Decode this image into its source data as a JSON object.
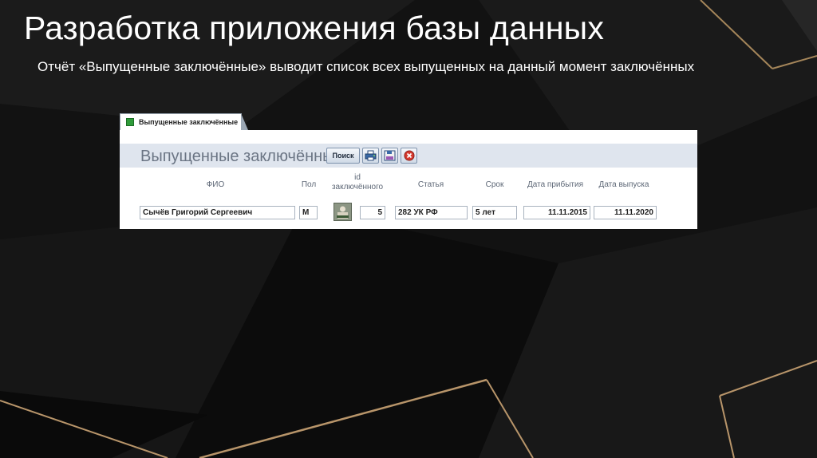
{
  "slide": {
    "title": "Разработка приложения базы данных",
    "subtitle": "Отчёт «Выпущенные заключённые» выводит список всех выпущенных на данный момент заключённых"
  },
  "form": {
    "tab_label": "Выпущенные заключённые",
    "caption": "Выпущенные заключённые",
    "search_label": "Поиск",
    "icons": {
      "print": "printer-icon",
      "save": "save-icon",
      "close": "close-icon"
    },
    "colors": {
      "header_band": "#dfe5ee",
      "caption_text": "#6b7584",
      "close_red": "#d63a2f"
    },
    "columns": {
      "fio": "ФИО",
      "gender": "Пол",
      "id_line1": "id",
      "id_line2": "заключённого",
      "article": "Статья",
      "term": "Срок",
      "arrival": "Дата прибытия",
      "release": "Дата выпуска"
    },
    "row": {
      "fio": "Сычёв Григорий Сергеевич",
      "gender": "М",
      "id": "5",
      "article": "282 УК РФ",
      "term": "5 лет",
      "arrival": "11.11.2015",
      "release": "11.11.2020"
    }
  }
}
